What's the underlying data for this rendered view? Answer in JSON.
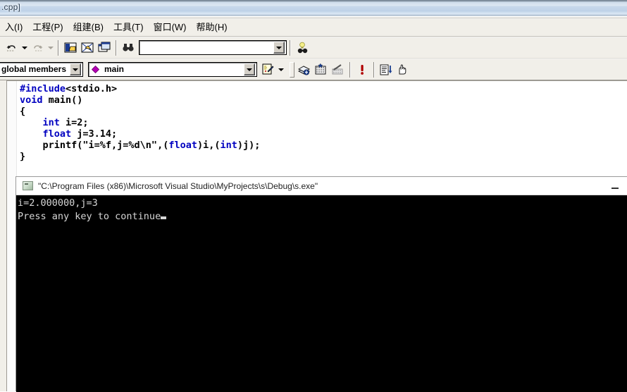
{
  "window": {
    "title": ".cpp]",
    "app_kind": "visual-cpp-ide"
  },
  "menu": {
    "items": [
      {
        "label": "入(I)",
        "name": "menu-insert"
      },
      {
        "label": "工程(P)",
        "name": "menu-project"
      },
      {
        "label": "组建(B)",
        "name": "menu-build"
      },
      {
        "label": "工具(T)",
        "name": "menu-tools"
      },
      {
        "label": "窗口(W)",
        "name": "menu-window"
      },
      {
        "label": "帮助(H)",
        "name": "menu-help"
      }
    ]
  },
  "toolbar_standard": {
    "undo_label": "undo-icon",
    "redo_label": "redo-icon",
    "workspace_label": "workspace-icon",
    "output_label": "output-window-icon",
    "window_list_label": "window-list-icon",
    "find_in_files_label": "find-in-files-icon",
    "search_value": "",
    "search_placeholder": "",
    "find_label": "find-icon"
  },
  "toolbar_wizardbar": {
    "scope_value": "global members",
    "member_value": "main",
    "member_icon": "member-diamond-icon",
    "action_label": "wizardbar-action-icon"
  },
  "toolbar_build": {
    "compile_label": "compile-icon",
    "build_label": "build-icon",
    "stop_build_label": "stop-build-icon",
    "execute_label": "execute-program-icon",
    "go_label": "go-debug-icon",
    "insert_breakpoint_label": "insert-breakpoint-icon"
  },
  "editor": {
    "filename_hint": ".cpp",
    "lines": [
      [
        {
          "t": "#include",
          "c": "pp"
        },
        {
          "t": "<stdio.h>",
          "c": ""
        }
      ],
      [
        {
          "t": "void",
          "c": "kw"
        },
        {
          "t": " main()",
          "c": ""
        }
      ],
      [
        {
          "t": "{",
          "c": ""
        }
      ],
      [
        {
          "t": "    ",
          "c": ""
        },
        {
          "t": "int",
          "c": "kw"
        },
        {
          "t": " i=2;",
          "c": ""
        }
      ],
      [
        {
          "t": "    ",
          "c": ""
        },
        {
          "t": "float",
          "c": "kw"
        },
        {
          "t": " j=3.14;",
          "c": ""
        }
      ],
      [
        {
          "t": "    printf(\"i=%f,j=%d\\n\",(",
          "c": ""
        },
        {
          "t": "float",
          "c": "kw"
        },
        {
          "t": ")i,(",
          "c": ""
        },
        {
          "t": "int",
          "c": "kw"
        },
        {
          "t": ")j);",
          "c": ""
        }
      ],
      [
        {
          "t": "}",
          "c": ""
        }
      ]
    ],
    "colors": {
      "keyword": "#0000c0",
      "text": "#000000",
      "background": "#ffffff"
    }
  },
  "console": {
    "title": "\"C:\\Program Files (x86)\\Microsoft Visual Studio\\MyProjects\\s\\Debug\\s.exe\"",
    "minimize_label": "minimize-icon",
    "lines": [
      "i=2.000000,j=3",
      "Press any key to continue"
    ],
    "colors": {
      "background": "#000000",
      "text": "#d6d6d6"
    }
  }
}
